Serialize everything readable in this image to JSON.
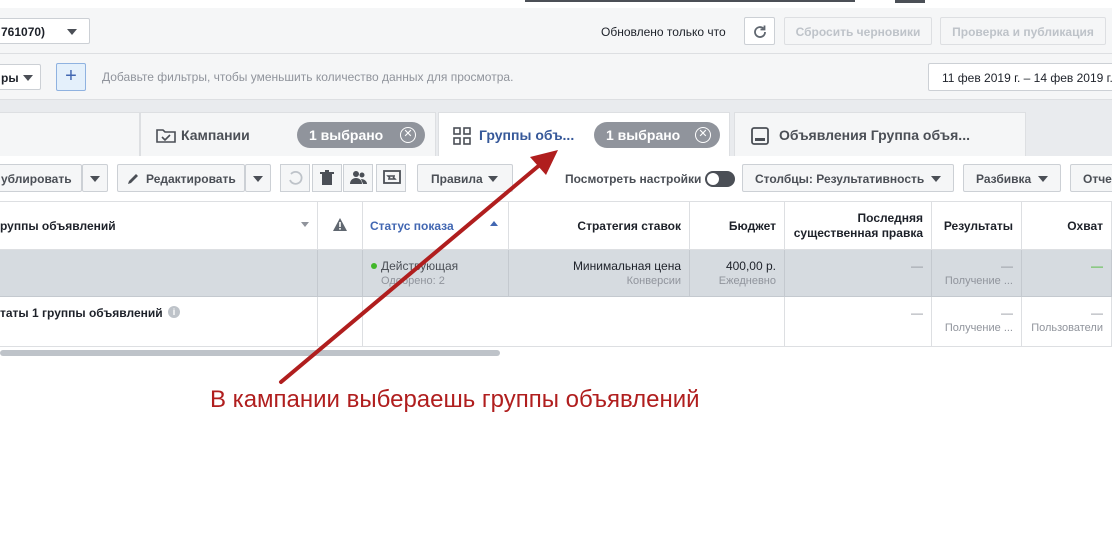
{
  "header": {
    "account_label": "761070)",
    "updated_text": "Обновлено только что",
    "discard_label": "Сбросить черновики",
    "publish_label": "Проверка и публикация"
  },
  "filterbar": {
    "filters_label": "ры",
    "add_label": "+",
    "placeholder": "Добавьте фильтры, чтобы уменьшить количество данных для просмотра.",
    "date_range": "11 фев 2019 г. – 14 фев 2019 г."
  },
  "tabs": [
    {
      "label": "Кампании",
      "badge": "1 выбрано"
    },
    {
      "label": "Группы объ...",
      "badge": "1 выбрано"
    },
    {
      "label": "Объявления Группа объя..."
    }
  ],
  "actions": {
    "duplicate_label": "ублировать",
    "edit_label": "Редактировать",
    "rules_label": "Правила",
    "view_settings_label": "Посмотреть настройки",
    "columns_label": "Столбцы: Результативность",
    "breakdown_label": "Разбивка",
    "reports_label": "Отче"
  },
  "table": {
    "columns": [
      "руппы объявлений",
      "Статус показа",
      "Стратегия ставок",
      "Бюджет",
      "Последняя существенная правка",
      "Результаты",
      "Охват"
    ],
    "rows": [
      {
        "status": "Действующая",
        "status_sub": "Одобрено: 2",
        "strategy": "Минимальная цена",
        "strategy_sub": "Конверсии",
        "budget": "400,00 р.",
        "budget_sub": "Ежедневно",
        "last_edit": "—",
        "results": "—",
        "results_sub": "Получение ...",
        "reach": "—"
      },
      {
        "name": "таты 1 группы объявлений",
        "last_edit": "—",
        "results": "—",
        "results_sub": "Получение ...",
        "reach": "—",
        "reach_sub": "Пользователи"
      }
    ]
  },
  "annotation": "В кампании выбераешь группы объявлений",
  "colors": {
    "accent": "#4267b2",
    "status_green": "#42b72a",
    "annotation_red": "#b01e1e"
  }
}
